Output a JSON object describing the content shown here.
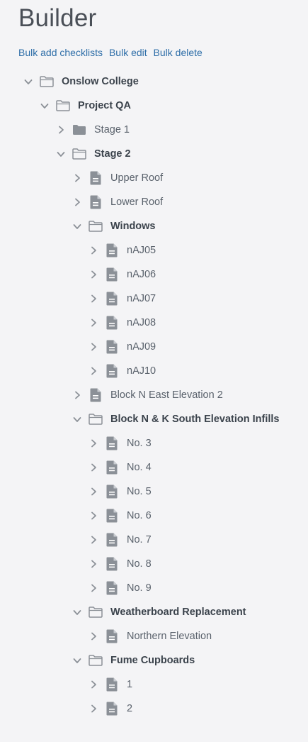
{
  "header": {
    "title": "Builder"
  },
  "actions": {
    "bulk_add": "Bulk add checklists",
    "bulk_edit": "Bulk edit",
    "bulk_delete": "Bulk delete"
  },
  "colors": {
    "link": "#2e6ea8",
    "icon": "#8b9097",
    "background": "#f4f4f6"
  },
  "tree": [
    {
      "label": "Onslow College",
      "depth": 0,
      "icon": "folder-open-icon",
      "expanded": true,
      "bold": true
    },
    {
      "label": "Project QA",
      "depth": 1,
      "icon": "folder-open-icon",
      "expanded": true,
      "bold": true
    },
    {
      "label": "Stage 1",
      "depth": 2,
      "icon": "folder-closed-icon",
      "expanded": false,
      "bold": false
    },
    {
      "label": "Stage 2",
      "depth": 2,
      "icon": "folder-open-icon",
      "expanded": true,
      "bold": true
    },
    {
      "label": "Upper Roof",
      "depth": 3,
      "icon": "document-icon",
      "expanded": false,
      "bold": false
    },
    {
      "label": "Lower Roof",
      "depth": 3,
      "icon": "document-icon",
      "expanded": false,
      "bold": false
    },
    {
      "label": "Windows",
      "depth": 3,
      "icon": "folder-open-icon",
      "expanded": true,
      "bold": true
    },
    {
      "label": "nAJ05",
      "depth": 4,
      "icon": "document-icon",
      "expanded": false,
      "bold": false
    },
    {
      "label": "nAJ06",
      "depth": 4,
      "icon": "document-icon",
      "expanded": false,
      "bold": false
    },
    {
      "label": "nAJ07",
      "depth": 4,
      "icon": "document-icon",
      "expanded": false,
      "bold": false
    },
    {
      "label": "nAJ08",
      "depth": 4,
      "icon": "document-icon",
      "expanded": false,
      "bold": false
    },
    {
      "label": "nAJ09",
      "depth": 4,
      "icon": "document-icon",
      "expanded": false,
      "bold": false
    },
    {
      "label": "nAJ10",
      "depth": 4,
      "icon": "document-icon",
      "expanded": false,
      "bold": false
    },
    {
      "label": "Block N East Elevation 2",
      "depth": 3,
      "icon": "document-icon",
      "expanded": false,
      "bold": false
    },
    {
      "label": "Block N & K South Elevation Infills",
      "depth": 3,
      "icon": "folder-open-icon",
      "expanded": true,
      "bold": true
    },
    {
      "label": "No. 3",
      "depth": 4,
      "icon": "document-icon",
      "expanded": false,
      "bold": false
    },
    {
      "label": "No. 4",
      "depth": 4,
      "icon": "document-icon",
      "expanded": false,
      "bold": false
    },
    {
      "label": "No. 5",
      "depth": 4,
      "icon": "document-icon",
      "expanded": false,
      "bold": false
    },
    {
      "label": "No. 6",
      "depth": 4,
      "icon": "document-icon",
      "expanded": false,
      "bold": false
    },
    {
      "label": "No. 7",
      "depth": 4,
      "icon": "document-icon",
      "expanded": false,
      "bold": false
    },
    {
      "label": "No. 8",
      "depth": 4,
      "icon": "document-icon",
      "expanded": false,
      "bold": false
    },
    {
      "label": "No. 9",
      "depth": 4,
      "icon": "document-icon",
      "expanded": false,
      "bold": false
    },
    {
      "label": "Weatherboard Replacement",
      "depth": 3,
      "icon": "folder-open-icon",
      "expanded": true,
      "bold": true
    },
    {
      "label": "Northern Elevation",
      "depth": 4,
      "icon": "document-icon",
      "expanded": false,
      "bold": false
    },
    {
      "label": "Fume Cupboards",
      "depth": 3,
      "icon": "folder-open-icon",
      "expanded": true,
      "bold": true
    },
    {
      "label": "1",
      "depth": 4,
      "icon": "document-icon",
      "expanded": false,
      "bold": false
    },
    {
      "label": "2",
      "depth": 4,
      "icon": "document-icon",
      "expanded": false,
      "bold": false
    }
  ]
}
